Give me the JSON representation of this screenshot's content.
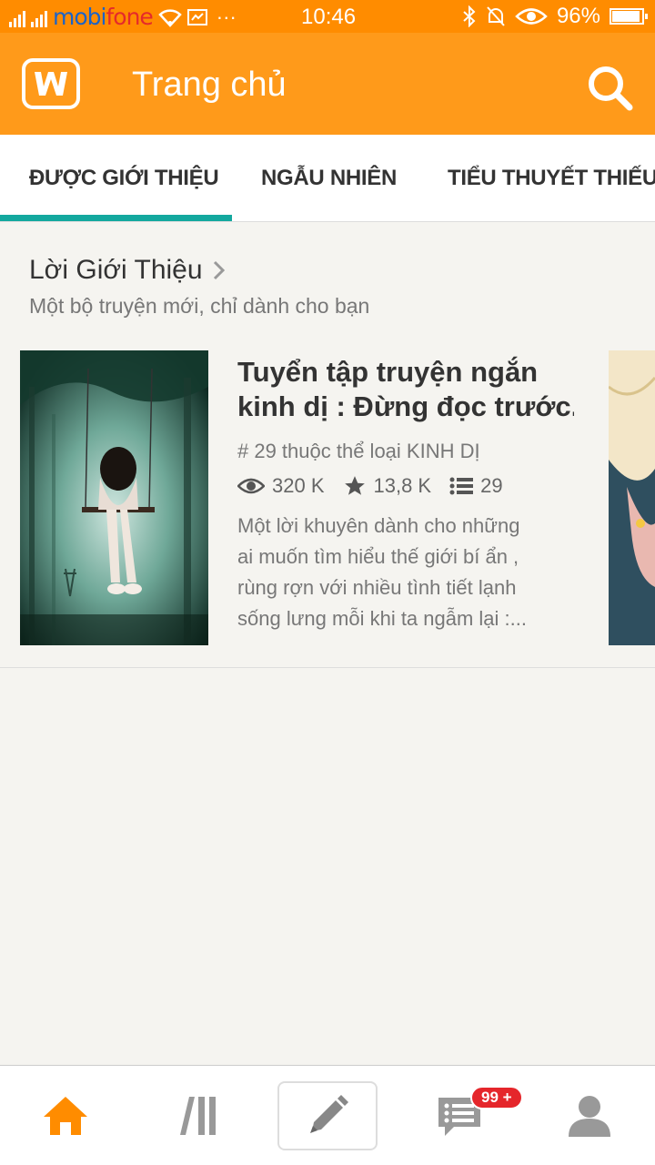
{
  "status_bar": {
    "carrier_mobi": "mobi",
    "carrier_fone": "fone",
    "time": "10:46",
    "battery": "96%"
  },
  "app_bar": {
    "title": "Trang chủ"
  },
  "tabs": [
    {
      "label": "ĐƯỢC GIỚI THIỆU"
    },
    {
      "label": "NGẪU NHIÊN"
    },
    {
      "label": "TIỂU THUYẾT THIẾU NIÊN"
    }
  ],
  "section": {
    "title": "Lời Giới Thiệu",
    "subtitle": "Một bộ truyện mới, chỉ dành cho bạn"
  },
  "story": {
    "title_line1": "Tuyển tập truyện ngắn",
    "title_line2": "kinh dị : Đừng đọc trước...",
    "tag": "# 29 thuộc thể loại KINH DỊ",
    "views": "320 K",
    "votes": "13,8 K",
    "parts": "29",
    "desc_line1": "Một lời khuyên dành cho những",
    "desc_line2": "ai muốn tìm hiểu thế giới bí ẩn ,",
    "desc_line3": "rùng rợn với nhiều tình tiết lạnh",
    "desc_line4": "sống lưng mỗi khi ta ngẫm lại :..."
  },
  "bottom_nav": {
    "badge": "99 +"
  },
  "colors": {
    "brand": "#ff9a1a",
    "status": "#ff8c00",
    "tab_accent": "#13a89e",
    "badge": "#e5262b",
    "home_active": "#ff8c00"
  }
}
